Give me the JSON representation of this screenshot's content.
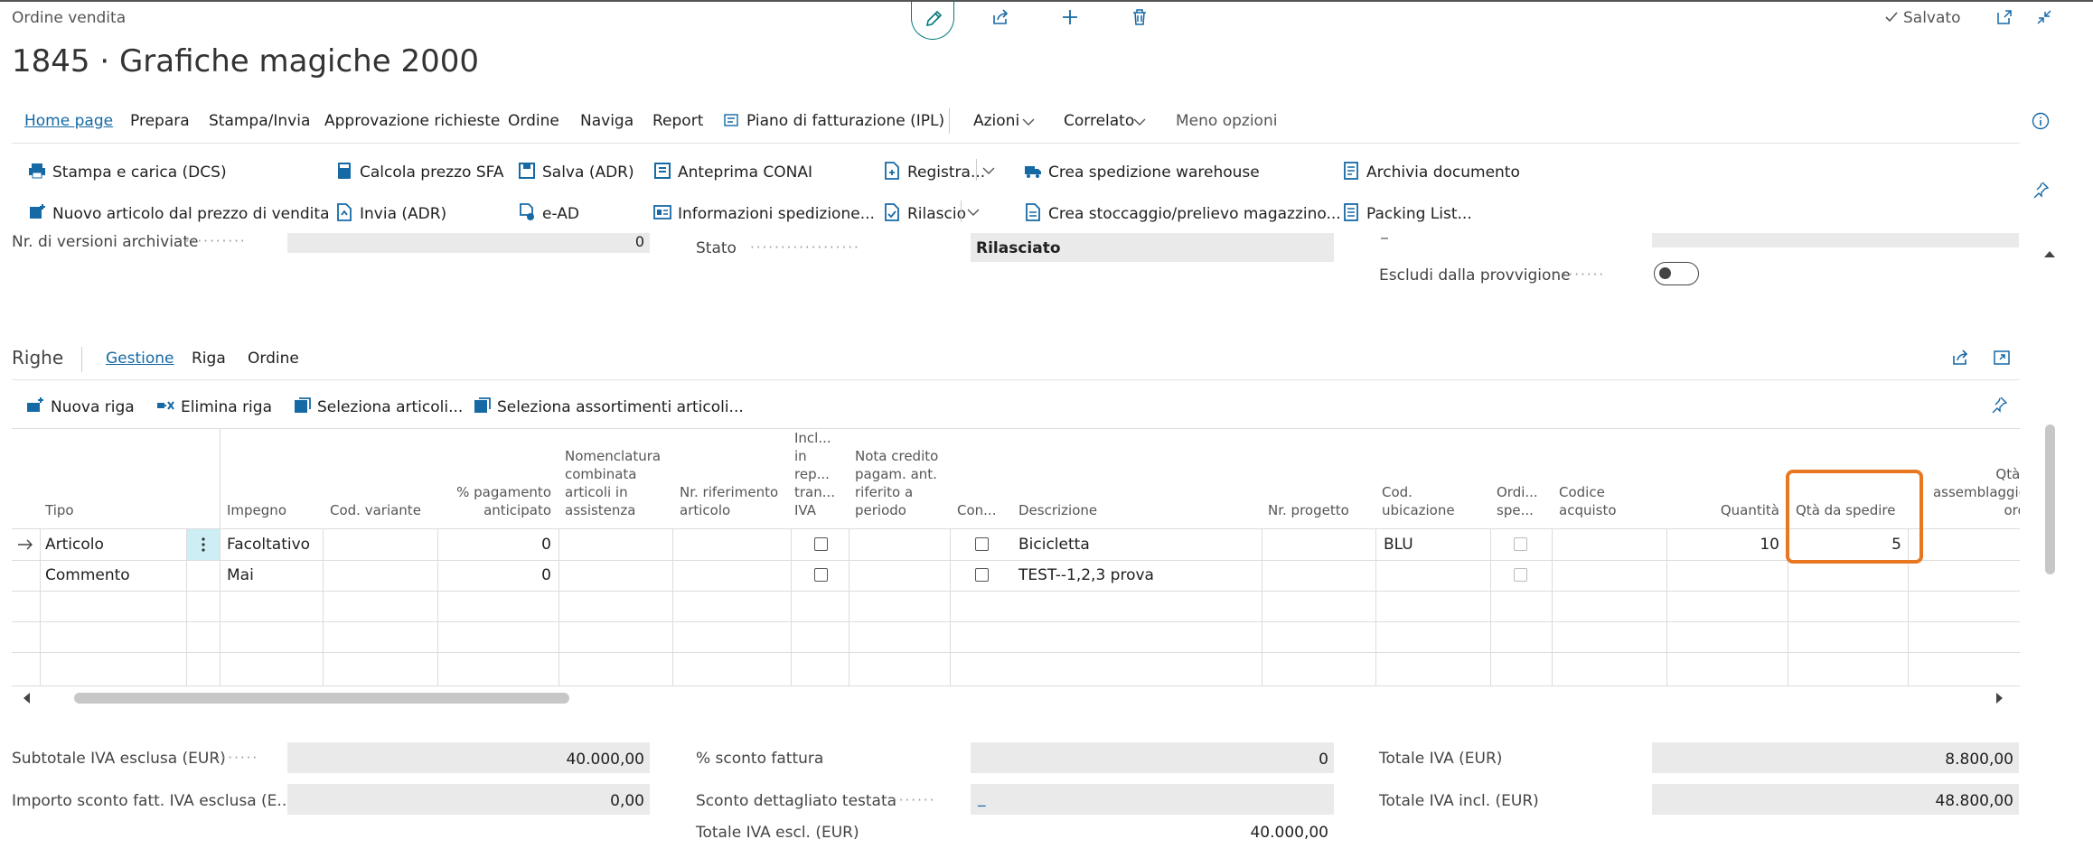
{
  "page": {
    "breadcrumb": "Ordine vendita",
    "title": "1845 · Grafiche magiche 2000",
    "saved": "Salvato"
  },
  "tabs": [
    "Home page",
    "Prepara",
    "Stampa/Invia",
    "Approvazione richieste",
    "Ordine",
    "Naviga",
    "Report",
    "Piano di fatturazione (IPL)",
    "Azioni",
    "Correlato",
    "Meno opzioni"
  ],
  "actions": {
    "r1": [
      "Stampa e carica (DCS)",
      "Calcola prezzo SFA",
      "Salva (ADR)",
      "Anteprima CONAI",
      "Registra...",
      "Crea spedizione warehouse",
      "Archivia documento"
    ],
    "r2": [
      "Nuovo articolo dal prezzo di vendita",
      "Invia (ADR)",
      "e-AD",
      "Informazioni spedizione...",
      "Rilascio",
      "Crea stoccaggio/prelievo magazzino...",
      "Packing List..."
    ]
  },
  "general": {
    "versions_label": "Nr. di versioni archiviate",
    "versions_value": "0",
    "stato_label": "Stato",
    "stato_value": "Rilasciato",
    "escludi_label": "Escludi dalla provvigione"
  },
  "lines": {
    "title": "Righe",
    "tabs": [
      "Gestione",
      "Riga",
      "Ordine"
    ],
    "actions": [
      "Nuova riga",
      "Elimina riga",
      "Seleziona articoli...",
      "Seleziona assortimenti articoli..."
    ],
    "headers": {
      "tipo": "Tipo",
      "impegno": "Impegno",
      "variante": "Cod. variante",
      "pagamento": "% pagamento anticipato",
      "nomenclatura": "Nomenclatura combinata articoli in assistenza",
      "riferimento": "Nr. riferimento articolo",
      "incl": "Incl... in rep... tran... IVA",
      "nota": "Nota credito pagam. ant. riferito a periodo",
      "con": "Con...",
      "descrizione": "Descrizione",
      "progetto": "Nr. progetto",
      "ubicazione": "Cod. ubicazione",
      "ordi": "Ordi... spe...",
      "acquisto": "Codice acquisto",
      "quantita": "Quantità",
      "qta_spedire": "Qtà da spedire",
      "qta_assemb": "Qtà per assemblaggio su ordine"
    },
    "rows": [
      {
        "tipo": "Articolo",
        "impegno": "Facoltativo",
        "pagamento": "0",
        "descrizione": "Bicicletta",
        "ubicazione": "BLU",
        "quantita": "10",
        "qta_spedire": "5"
      },
      {
        "tipo": "Commento",
        "impegno": "Mai",
        "pagamento": "0",
        "descrizione": "TEST--1,2,3 prova",
        "ubicazione": "",
        "quantita": "",
        "qta_spedire": ""
      }
    ]
  },
  "totals": {
    "subtotale_label": "Subtotale IVA esclusa (EUR)",
    "subtotale_value": "40.000,00",
    "importo_label": "Importo sconto fatt. IVA esclusa (E...",
    "importo_value": "0,00",
    "sconto_label": "% sconto fattura",
    "sconto_value": "0",
    "dettagliato_label": "Sconto dettagliato testata",
    "dettagliato_value": "_",
    "totale_escl_label": "Totale IVA escl. (EUR)",
    "totale_escl_value": "40.000,00",
    "totale_iva_label": "Totale IVA (EUR)",
    "totale_iva_value": "8.800,00",
    "totale_incl_label": "Totale IVA incl. (EUR)",
    "totale_incl_value": "48.800,00"
  },
  "colors": {
    "accent": "#1569a5",
    "highlight": "#e87722",
    "teal": "#00797a",
    "selected": "#cdeef5"
  }
}
